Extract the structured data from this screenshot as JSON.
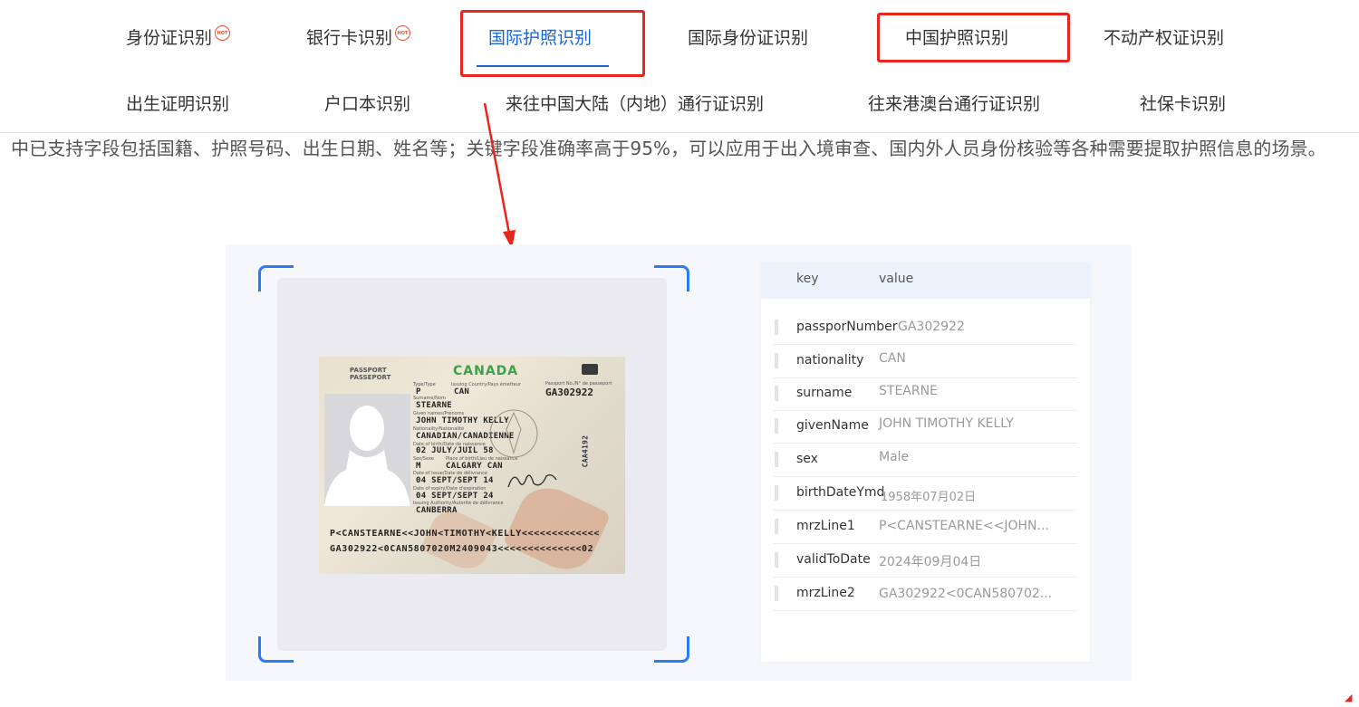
{
  "tabs_row1": [
    {
      "label": "身份证识别",
      "hot": true
    },
    {
      "label": "银行卡识别",
      "hot": true
    },
    {
      "label": "国际护照识别",
      "hot": false,
      "active": true
    },
    {
      "label": "国际身份证识别",
      "hot": false
    },
    {
      "label": "中国护照识别",
      "hot": false
    },
    {
      "label": "不动产权证识别",
      "hot": false
    }
  ],
  "tabs_row2": [
    {
      "label": "出生证明识别"
    },
    {
      "label": "户口本识别"
    },
    {
      "label": "来往中国大陆（内地）通行证识别"
    },
    {
      "label": "往来港澳台通行证识别"
    },
    {
      "label": "社保卡识别"
    }
  ],
  "hot_badge": "HOT",
  "description": "中已支持字段包括国籍、护照号码、出生日期、姓名等；关键字段准确率高于95%，可以应用于出入境审查、国内外人员身份核验等各种需要提取护照信息的场景。",
  "colors": {
    "accent": "#1a66d6",
    "highlight_box": "#e8261f",
    "scan_corner": "#2a7bf4"
  },
  "passport": {
    "header": "PASSPORT\nPASSEPORT",
    "country": "CANADA",
    "type_label": "Type/Type",
    "type": "P",
    "issuing_label": "Issuing Country/Pays émetteur",
    "issuing": "CAN",
    "number_label": "Passport No./N° de passeport",
    "number": "GA302922",
    "surname_label": "Surname/Nom",
    "surname": "STEARNE",
    "given_label": "Given names/Prénoms",
    "given": "JOHN TIMOTHY KELLY",
    "nationality_label": "Nationality/Nationalité",
    "nationality": "CANADIAN/CANADIENNE",
    "dob_label": "Date of birth/Date de naissance",
    "dob": "02 JULY/JUIL 58",
    "sex_label": "Sex/Sexe",
    "sex": "M",
    "pob_label": "Place of birth/Lieu de naissance",
    "pob": "CALGARY CAN",
    "issue_label": "Date of issue/Date de délivrance",
    "issue": "04 SEPT/SEPT 14",
    "expiry_label": "Date of expiry/Date d'expiration",
    "expiry": "04 SEPT/SEPT 24",
    "authority_label": "Issuing Authority/Autorité de délivrance",
    "authority": "CANBERRA",
    "mrz1": "P<CANSTEARNE<<JOHN<TIMOTHY<KELLY<<<<<<<<<<<<<",
    "mrz2": "GA302922<0CAN5807020M2409043<<<<<<<<<<<<<<02",
    "side_number": "CAA4192"
  },
  "result_table": {
    "header_key": "key",
    "header_value": "value",
    "rows": [
      {
        "key": "passporNumber",
        "value": "GA302922"
      },
      {
        "key": "nationality",
        "value": "CAN"
      },
      {
        "key": "surname",
        "value": "STEARNE"
      },
      {
        "key": "givenName",
        "value": "JOHN TIMOTHY KELLY"
      },
      {
        "key": "sex",
        "value": "Male"
      },
      {
        "key": "birthDateYmd",
        "value": "1958年07月02日"
      },
      {
        "key": "mrzLine1",
        "value": "P<CANSTEARNE<<JOHN..."
      },
      {
        "key": "validToDate",
        "value": "2024年09月04日"
      },
      {
        "key": "mrzLine2",
        "value": "GA302922<0CAN580702..."
      }
    ]
  }
}
